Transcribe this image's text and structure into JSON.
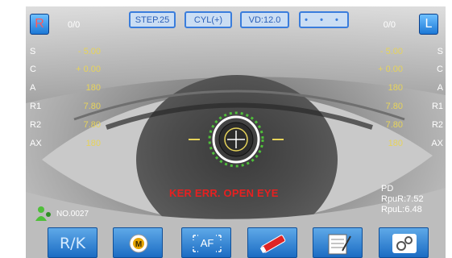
{
  "header": {
    "right_eye_badge": "R",
    "left_eye_badge": "L",
    "right_count": "0/0",
    "left_count": "0/0",
    "step_label": "STEP.25",
    "cyl_label": "CYL(+)",
    "vd_label": "VD:12.0",
    "dots_label": "• • •"
  },
  "measurements": {
    "labels": [
      "S",
      "C",
      "A",
      "R1",
      "R2",
      "AX"
    ],
    "right": [
      "- 5.00",
      "+ 0.00",
      "180",
      "7.80",
      "7.80",
      "180"
    ],
    "left": [
      "- 5.00",
      "+ 0.00",
      "180",
      "7.80",
      "7.80",
      "180"
    ]
  },
  "status": {
    "error": "KER ERR. OPEN EYE",
    "patient_no": "NO.0027"
  },
  "pupil": {
    "title": "PD",
    "right": "RpuR:7.52",
    "left": "RpuL:6.48"
  },
  "toolbar": {
    "rk_label": "R/K",
    "af_label": "AF"
  },
  "colors": {
    "accent": "#1b6cc3",
    "value_yellow": "#e6d35a",
    "error_red": "#e82020"
  }
}
